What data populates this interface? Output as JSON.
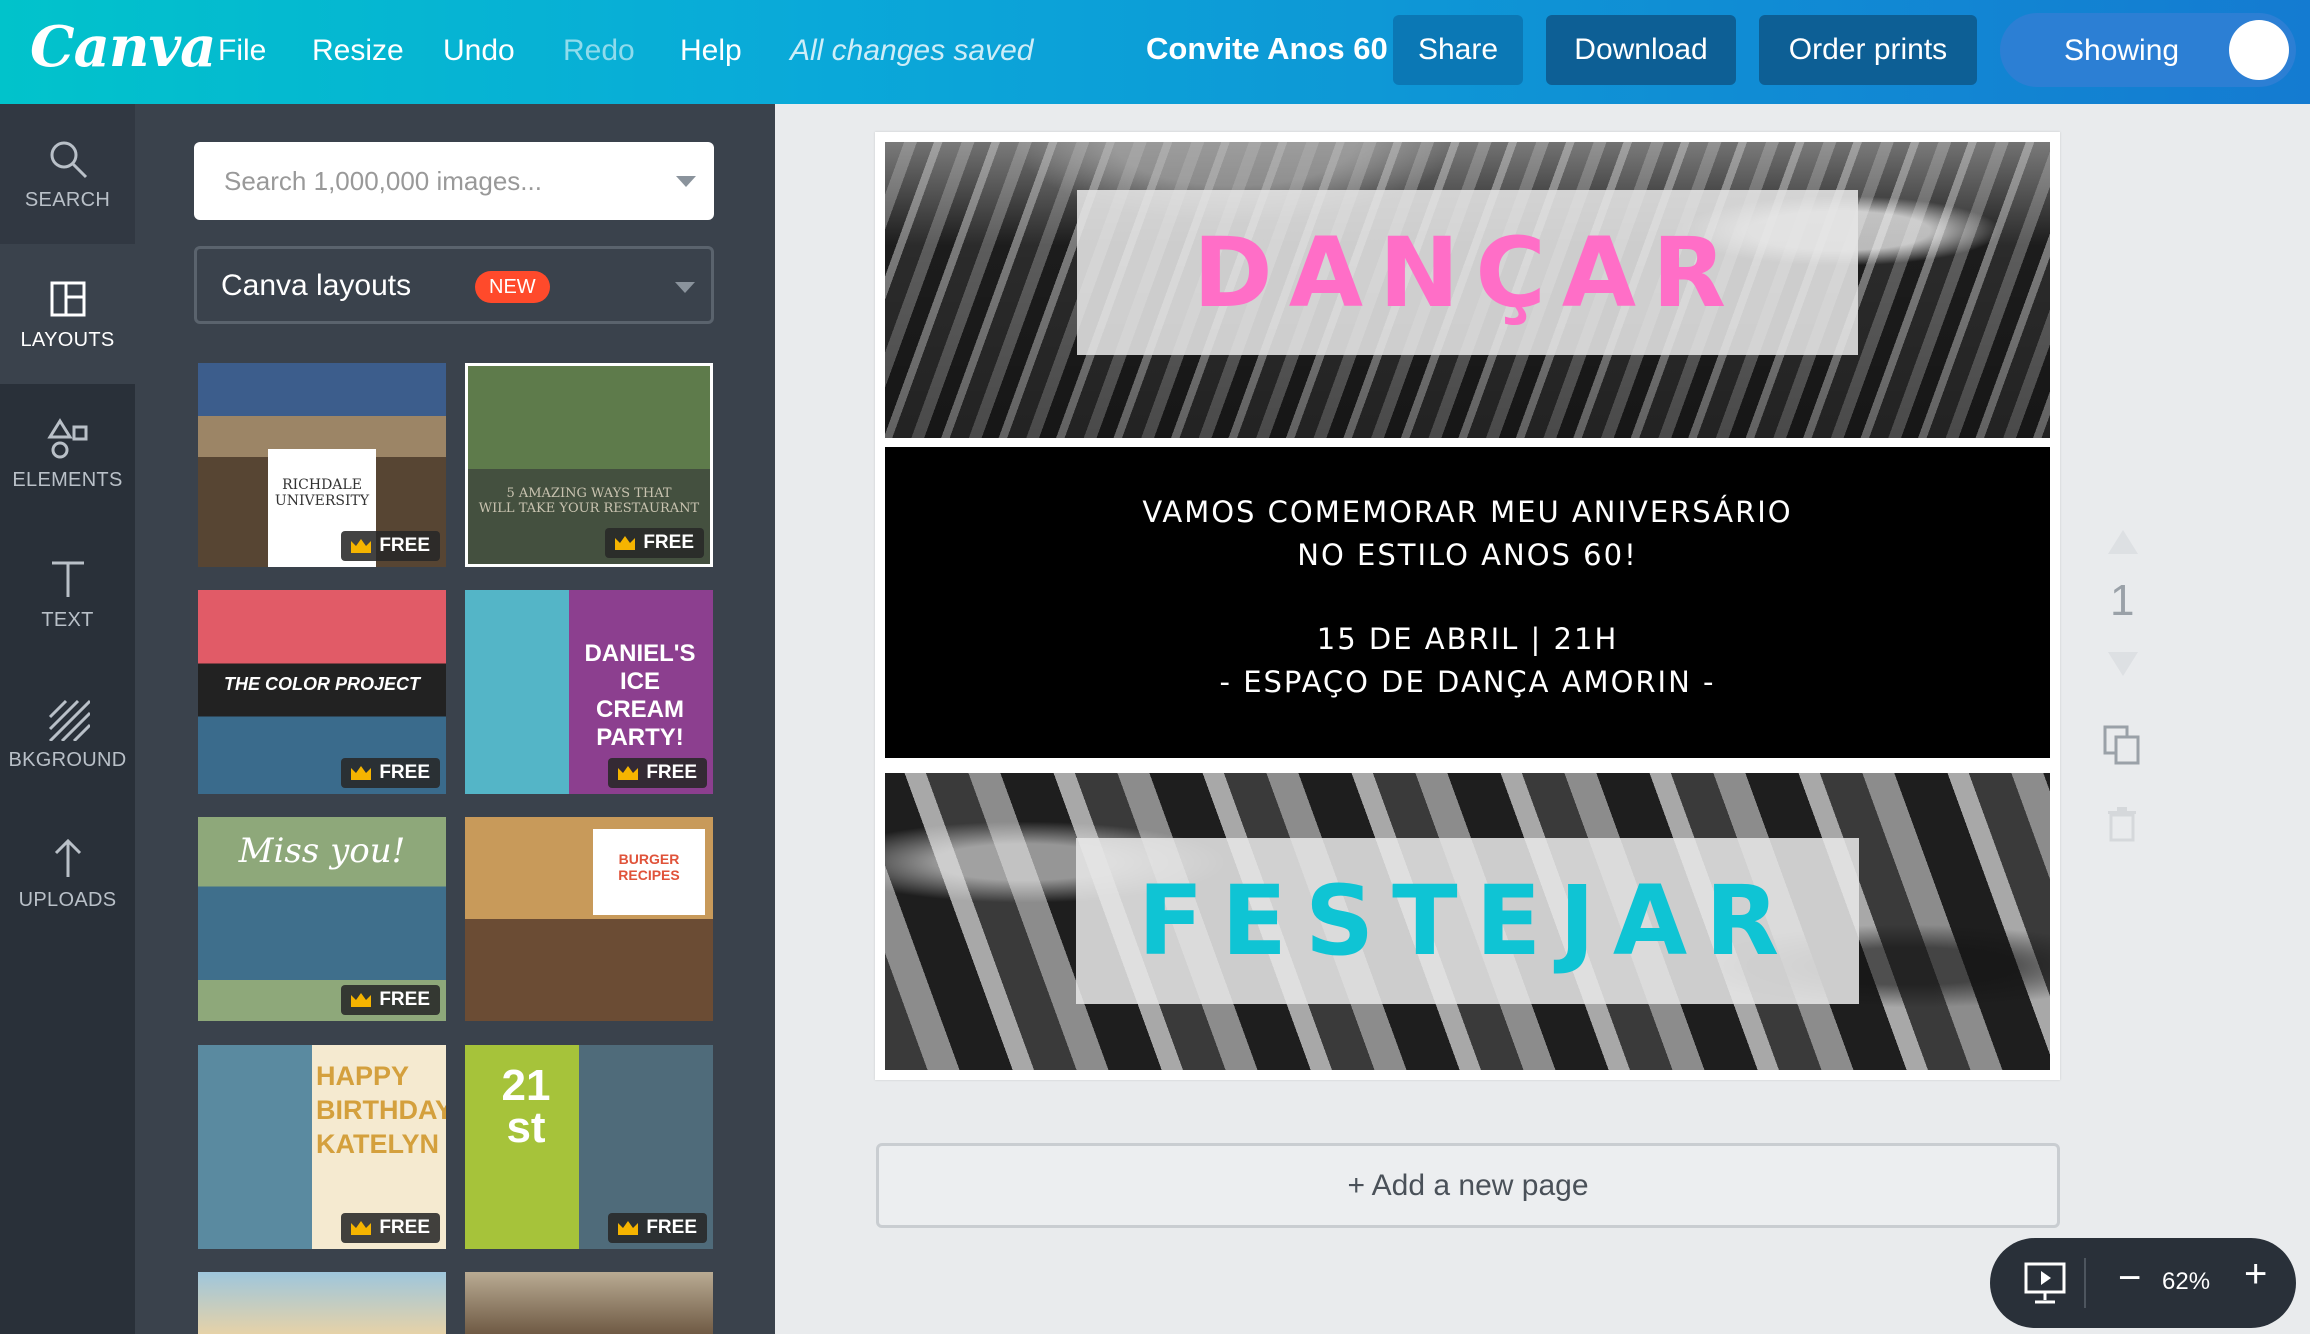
{
  "app": {
    "logo": "Canva"
  },
  "topbar": {
    "menu": [
      "File",
      "Resize",
      "Undo",
      "Redo",
      "Help"
    ],
    "saved_status": "All changes saved",
    "doc_title": "Convite Anos 60",
    "share": "Share",
    "download": "Download",
    "order_prints": "Order prints",
    "showing": "Showing"
  },
  "rail": [
    {
      "label": "SEARCH",
      "icon": "search-icon"
    },
    {
      "label": "LAYOUTS",
      "icon": "layouts-icon"
    },
    {
      "label": "ELEMENTS",
      "icon": "elements-icon"
    },
    {
      "label": "TEXT",
      "icon": "text-icon"
    },
    {
      "label": "BKGROUND",
      "icon": "background-icon"
    },
    {
      "label": "UPLOADS",
      "icon": "upload-icon"
    }
  ],
  "panel": {
    "search_placeholder": "Search 1,000,000 images...",
    "layouts_label": "Canva layouts",
    "new_badge": "NEW",
    "free_label": "FREE",
    "thumbs": [
      {
        "line1": "RICHDALE",
        "line2": "UNIVERSITY"
      },
      {
        "line1": "5 AMAZING WAYS THAT",
        "line2": "WILL TAKE YOUR RESTAURANT"
      },
      {
        "line1": "THE COLOR PROJECT",
        "line2": ""
      },
      {
        "line1": "DANIEL'S",
        "line2": "ICE CREAM PARTY!"
      },
      {
        "line1": "Miss you!",
        "line2": ""
      },
      {
        "line1": "BURGER",
        "line2": "RECIPES"
      },
      {
        "line1": "HAPPY",
        "line2": "BIRTHDAY KATELYN"
      },
      {
        "line1": "21",
        "line2": "st"
      }
    ]
  },
  "design": {
    "heading1": "DANÇAR",
    "line1": "VAMOS COMEMORAR MEU ANIVERSÁRIO",
    "line2": "NO ESTILO ANOS 60!",
    "line3": "15 DE ABRIL | 21H",
    "line4": "- ESPAÇO DE DANÇA AMORIN -",
    "heading2": "FESTEJAR",
    "heading1_color": "#ff6ec7",
    "heading2_color": "#0fc4d4"
  },
  "page_number": "1",
  "add_page": "+ Add a new page",
  "zoom": "62%"
}
